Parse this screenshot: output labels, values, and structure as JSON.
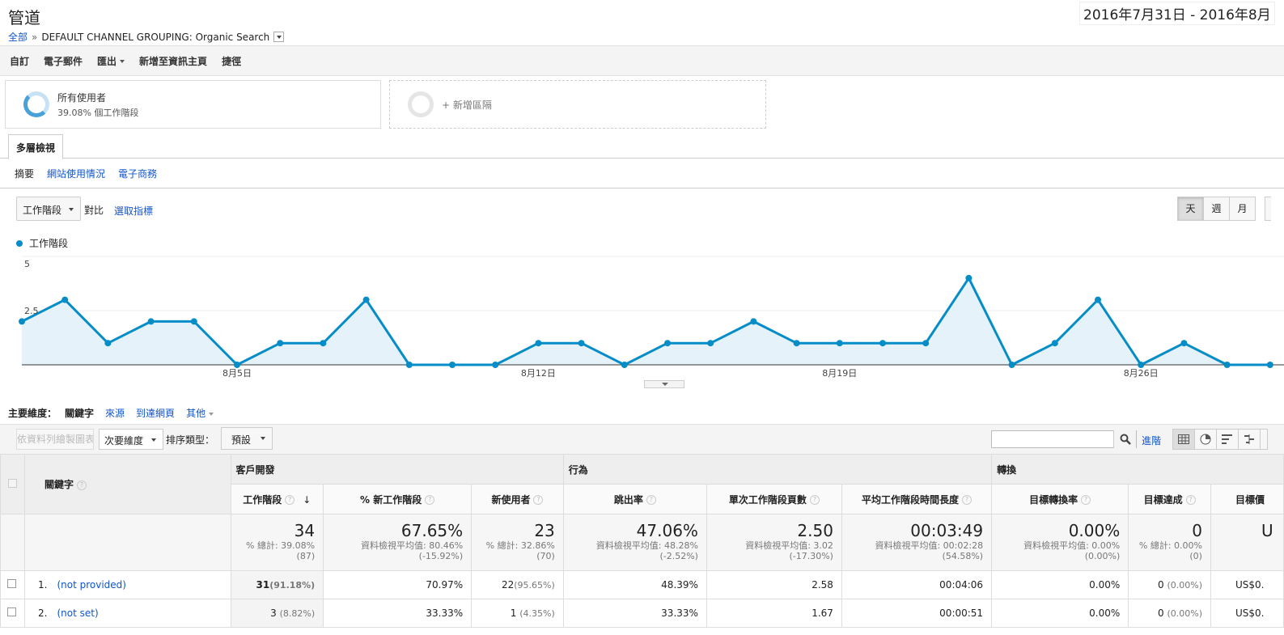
{
  "header": {
    "title": "管道",
    "date_range": "2016年7月31日 - 2016年8月",
    "breadcrumb_root": "全部",
    "breadcrumb_sep": "»",
    "breadcrumb_current": "DEFAULT CHANNEL GROUPING: Organic Search"
  },
  "toolbar": {
    "custom": "自訂",
    "email": "電子郵件",
    "export": "匯出",
    "add_dashboard": "新增至資訊主頁",
    "shortcut": "捷徑"
  },
  "segments": {
    "all_users": "所有使用者",
    "all_users_sub": "39.08% 個工作階段",
    "add_segment": "+ 新增區隔"
  },
  "tabs": {
    "explorer": "多層檢視"
  },
  "subtabs": [
    "摘要",
    "網站使用情況",
    "電子商務"
  ],
  "chart_controls": {
    "metric": "工作階段",
    "vs": "對比",
    "pick_metric": "選取指標",
    "day": "天",
    "week": "週",
    "month": "月"
  },
  "chart_data": {
    "type": "area",
    "series": [
      {
        "name": "工作階段",
        "values": [
          2,
          3,
          1,
          2,
          2,
          0,
          1,
          1,
          3,
          0,
          0,
          0,
          1,
          1,
          0,
          1,
          1,
          2,
          1,
          1,
          1,
          1,
          4,
          0,
          1,
          3,
          0,
          1,
          0,
          0
        ]
      }
    ],
    "y_ticks": [
      "5",
      "2.5"
    ],
    "ylim": [
      0,
      5
    ],
    "x_labels": [
      "8月5日",
      "8月12日",
      "8月19日",
      "8月26日"
    ],
    "colors": {
      "line": "#058dc7",
      "fill": "#e6f2f9"
    }
  },
  "dimension": {
    "label": "主要維度：",
    "current": "關鍵字",
    "options": [
      "來源",
      "到達網頁",
      "其他"
    ]
  },
  "table_toolbar": {
    "plot_rows": "依資料列繪製圖表",
    "secondary": "次要維度",
    "sort_label": "排序類型：",
    "sort_value": "預設",
    "advanced": "進階"
  },
  "table": {
    "dim_header": "關鍵字",
    "groups": [
      "客戶開發",
      "行為",
      "轉換"
    ],
    "columns": [
      "工作階段",
      "% 新工作階段",
      "新使用者",
      "跳出率",
      "單次工作階段頁數",
      "平均工作階段時間長度",
      "目標轉換率",
      "目標達成",
      "目標價"
    ],
    "totals": [
      {
        "big": "34",
        "s1": "% 總計: 39.08%",
        "s2": "(87)"
      },
      {
        "big": "67.65%",
        "s1": "資料檢視平均值: 80.46%",
        "s2": "(-15.92%)"
      },
      {
        "big": "23",
        "s1": "% 總計: 32.86%",
        "s2": "(70)"
      },
      {
        "big": "47.06%",
        "s1": "資料檢視平均值: 48.28%",
        "s2": "(-2.52%)"
      },
      {
        "big": "2.50",
        "s1": "資料檢視平均值: 3.02",
        "s2": "(-17.30%)"
      },
      {
        "big": "00:03:49",
        "s1": "資料檢視平均值: 00:02:28",
        "s2": "(54.58%)"
      },
      {
        "big": "0.00%",
        "s1": "資料檢視平均值: 0.00%",
        "s2": "(0.00%)"
      },
      {
        "big": "0",
        "s1": "% 總計: 0.00%",
        "s2": "(0)"
      },
      {
        "big": "U",
        "s1": "",
        "s2": ""
      }
    ],
    "rows": [
      {
        "idx": "1.",
        "key": "(not provided)",
        "sessions": "31",
        "sessions_pct": "(91.18%)",
        "new_pct": "70.97%",
        "new_users": "22",
        "new_users_pct": "(95.65%)",
        "bounce": "48.39%",
        "pages": "2.58",
        "duration": "00:04:06",
        "conv_rate": "0.00%",
        "goals": "0",
        "goals_pct": "(0.00%)",
        "value": "US$0."
      },
      {
        "idx": "2.",
        "key": "(not set)",
        "sessions": "3",
        "sessions_pct": "(8.82%)",
        "new_pct": "33.33%",
        "new_users": "1",
        "new_users_pct": "(4.35%)",
        "bounce": "33.33%",
        "pages": "1.67",
        "duration": "00:00:51",
        "conv_rate": "0.00%",
        "goals": "0",
        "goals_pct": "(0.00%)",
        "value": "US$0."
      }
    ]
  }
}
